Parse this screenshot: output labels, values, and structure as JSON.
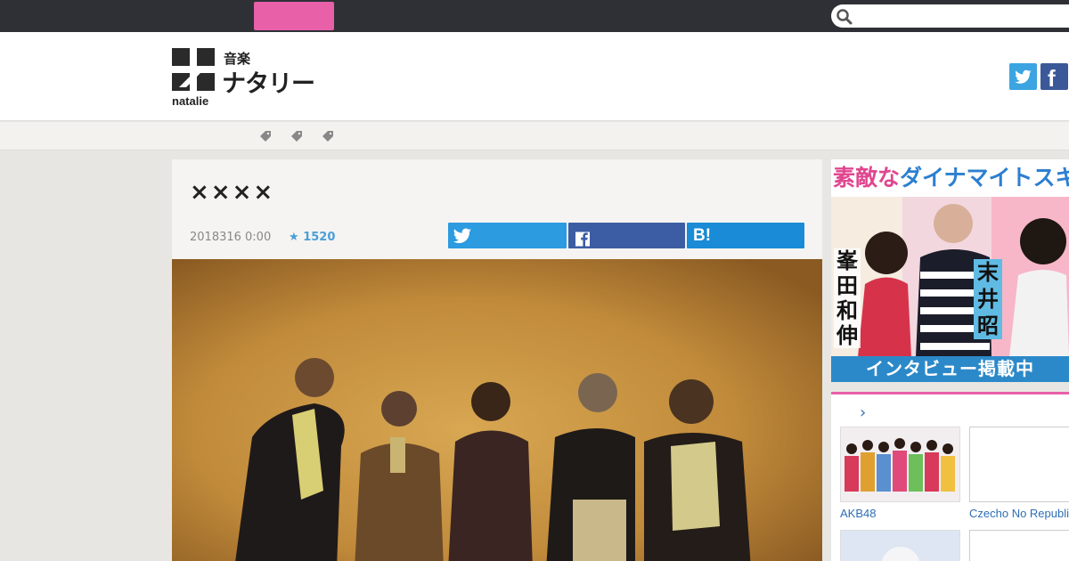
{
  "topbar": {
    "search": {
      "placeholder": "",
      "icon": "search-icon"
    }
  },
  "header": {
    "logo": {
      "small": "音楽",
      "big": "ナタリー",
      "sub": "natalie"
    },
    "sns": {
      "facebook_glyph": "f"
    }
  },
  "subnav": {
    "tags": [
      "tag-icon",
      "tag-icon",
      "tag-icon"
    ]
  },
  "article": {
    "title": "××××",
    "date": "2018316 0:00",
    "star_count": "1520",
    "share": {
      "hatena_label": "B!"
    }
  },
  "sidebar": {
    "ad": {
      "headline_a": "素敵な",
      "headline_b": "ダイナマイトスキャンダ",
      "name1": "峯田和伸",
      "name2": "末井昭",
      "footer": "インタビュー掲載中"
    },
    "related": {
      "items": [
        {
          "label": "AKB48"
        },
        {
          "label": "Czecho No Republic"
        }
      ]
    }
  },
  "colors": {
    "topbar": "#2e3035",
    "accent_pink": "#e860a8",
    "twitter": "#2c9be0",
    "facebook": "#3c5da3",
    "hatena": "#1a8bd6",
    "link": "#2f6eb5"
  }
}
